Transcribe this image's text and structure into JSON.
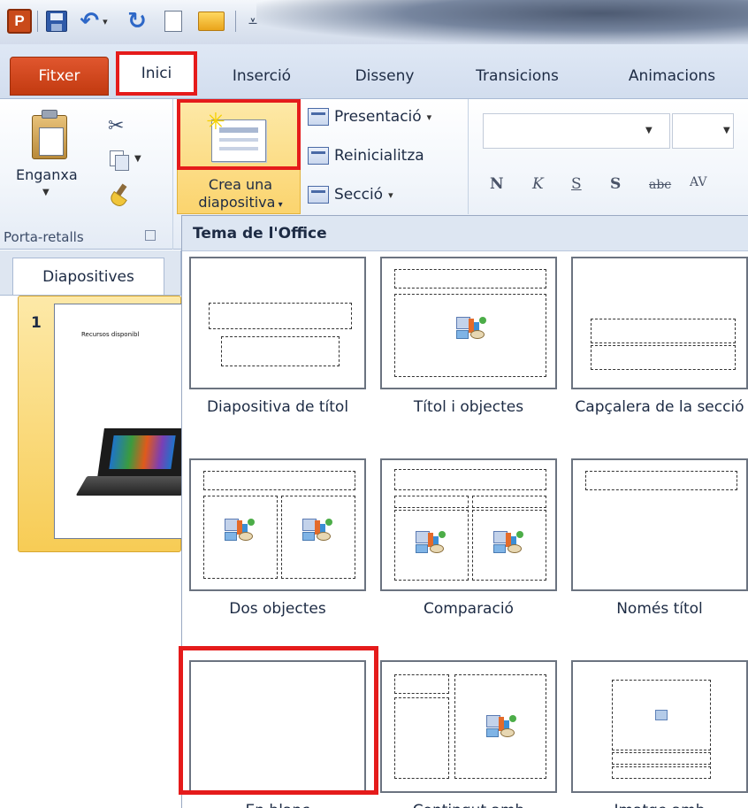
{
  "app": {
    "logo_letter": "P"
  },
  "tabs": {
    "file": "Fitxer",
    "home": "Inici",
    "insert": "Inserció",
    "design": "Disseny",
    "transitions": "Transicions",
    "animations": "Animacions"
  },
  "ribbon": {
    "clipboard": {
      "paste": "Enganxa",
      "group_label": "Porta-retalls"
    },
    "slides": {
      "new_slide_line1": "Crea una",
      "new_slide_line2": "diapositiva",
      "layout": "Presentació",
      "reset": "Reinicialitza",
      "section": "Secció"
    },
    "font": {
      "bold": "N",
      "italic": "K",
      "underline": "S",
      "shadow": "S",
      "strike": "abc",
      "spacing": "AV"
    }
  },
  "left_pane": {
    "tab_label": "Diapositives",
    "slide_number": "1",
    "slide_title": "Recursos disponibl"
  },
  "layout_menu": {
    "header": "Tema de l'Office",
    "layouts": [
      {
        "name": "Diapositiva de títol"
      },
      {
        "name": "Títol i objectes"
      },
      {
        "name": "Capçalera de la secció"
      },
      {
        "name": "Dos objectes"
      },
      {
        "name": "Comparació"
      },
      {
        "name": "Només títol"
      },
      {
        "name": "En blanc"
      },
      {
        "name": "Contingut amb"
      },
      {
        "name": "Imatge amb"
      }
    ]
  },
  "colors": {
    "highlight": "#e51b1b",
    "file_tab": "#c94a1a",
    "selection": "#fbd46e"
  }
}
